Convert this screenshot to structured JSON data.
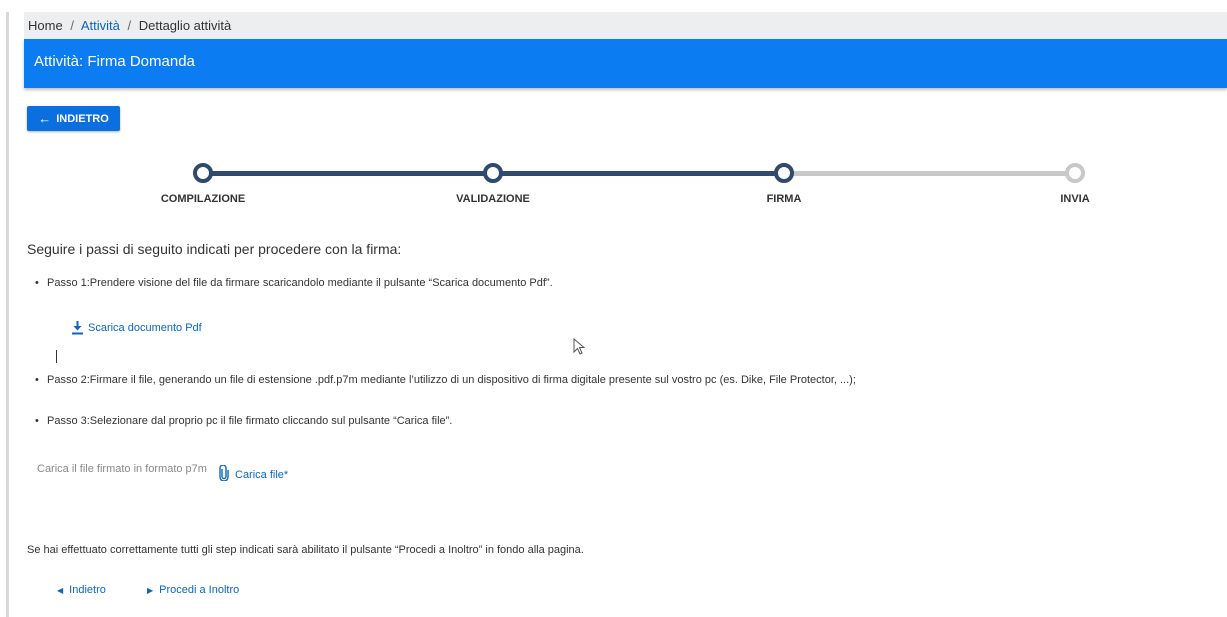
{
  "breadcrumb": {
    "home": "Home",
    "separator": "/",
    "activities": "Attività",
    "current": "Dettaglio attività"
  },
  "title": "Attività: Firma Domanda",
  "back_button": {
    "arrow": "←",
    "label": "INDIETRO"
  },
  "stepper": {
    "steps": [
      {
        "label": "COMPILAZIONE",
        "state": "done"
      },
      {
        "label": "VALIDAZIONE",
        "state": "done"
      },
      {
        "label": "FIRMA",
        "state": "current"
      },
      {
        "label": "INVIA",
        "state": "todo"
      }
    ],
    "colors": {
      "done": "#2f4a6e",
      "todo": "#c8c8c8"
    }
  },
  "instructions": {
    "intro": "Seguire i passi di seguito indicati per procedere con la firma:",
    "step1": "Passo 1:Prendere visione del file da firmare scaricandolo mediante il pulsante “Scarica documento Pdf”.",
    "step2": "Passo 2:Firmare il file, generando un file di estensione .pdf.p7m mediante l’utilizzo di un dispositivo di firma digitale presente sul vostro pc (es. Dike, File Protector, ...);",
    "step3": "Passo 3:Selezionare dal proprio pc il file firmato cliccando sul pulsante “Carica file”."
  },
  "download": {
    "icon": "download-icon",
    "label": "Scarica documento Pdf"
  },
  "upload": {
    "label": "Carica il file firmato in formato p7m",
    "icon": "paperclip-icon",
    "button": "Carica file*"
  },
  "final_note": "Se hai effettuato correttamente tutti gli step indicati sarà abilitato il pulsante “Procedi a Inoltro” in fondo alla pagina.",
  "footer_nav": {
    "back": {
      "icon": "caret-left-icon",
      "label": "Indietro"
    },
    "forward": {
      "icon": "caret-right-icon",
      "label": "Procedi a Inoltro"
    }
  },
  "colors": {
    "primary": "#0b7cf2",
    "link": "#0a66c2",
    "header_bg": "#eceef0"
  }
}
